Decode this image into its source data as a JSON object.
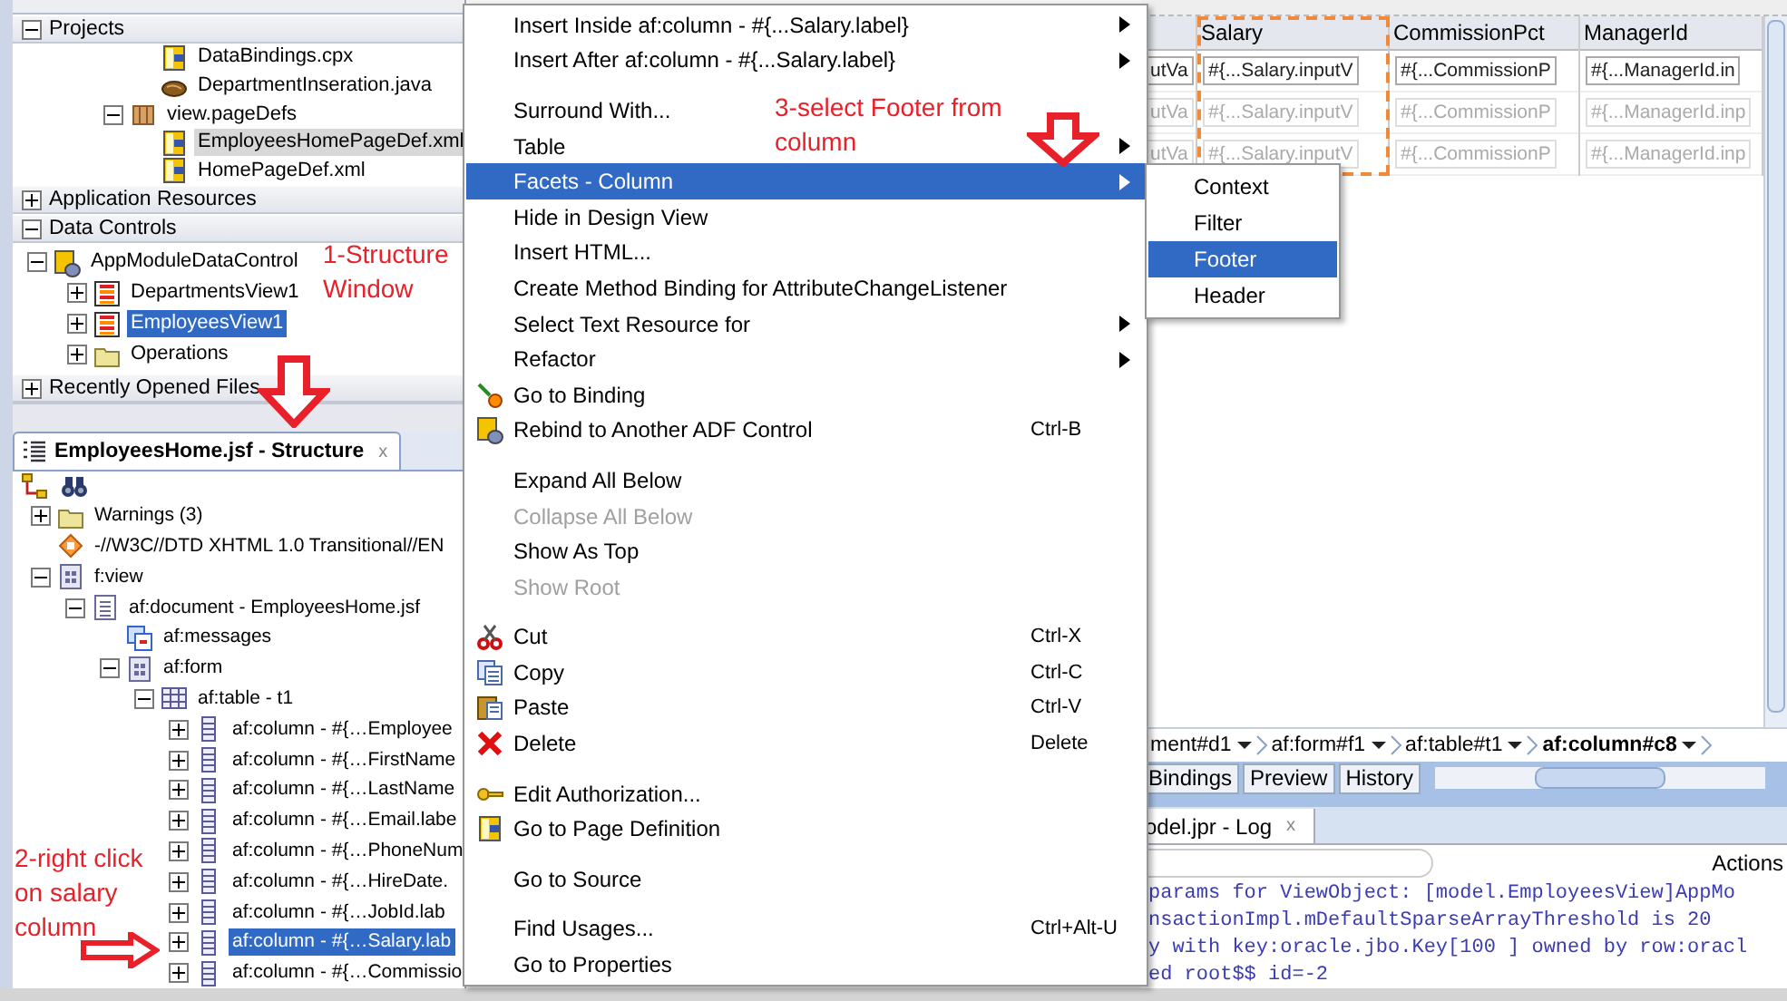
{
  "navigator": {
    "projects": {
      "header": "Projects",
      "expanded": true,
      "scrolled_items": [
        {
          "label": "DataBindings.cpx",
          "kind": "xml-file",
          "selected": false
        },
        {
          "label": "DepartmentInseration.java",
          "kind": "java-file",
          "selected": false
        }
      ],
      "items": [
        {
          "label": "view.pageDefs",
          "kind": "package",
          "expanded": true,
          "selected": false,
          "children": [
            {
              "label": "EmployeesHomePageDef.xml",
              "kind": "xml-file",
              "selected": true
            },
            {
              "label": "HomePageDef.xml",
              "kind": "xml-file",
              "selected": false
            }
          ]
        }
      ]
    },
    "application_resources": {
      "header": "Application Resources",
      "expanded": false
    },
    "data_controls": {
      "header": "Data Controls",
      "expanded": true,
      "items": [
        {
          "label": "AppModuleDataControl",
          "kind": "data-control",
          "expanded": true,
          "selected": false,
          "children": [
            {
              "label": "DepartmentsView1",
              "kind": "view-object",
              "expanded": false,
              "selected": false
            },
            {
              "label": "EmployeesView1",
              "kind": "view-object",
              "expanded": false,
              "selected": true
            },
            {
              "label": "Operations",
              "kind": "folder",
              "expanded": false,
              "selected": false
            }
          ]
        }
      ]
    },
    "recently_opened_files": {
      "header": "Recently Opened Files",
      "expanded": false
    }
  },
  "structure": {
    "tab": {
      "title": "EmployeesHome.jsf - Structure",
      "close": "x"
    },
    "items": [
      {
        "label": "Warnings (3)",
        "kind": "folder",
        "expanded": false,
        "selected": false
      },
      {
        "label": "-//W3C//DTD XHTML 1.0 Transitional//EN",
        "kind": "doctype",
        "selected": false
      },
      {
        "label": "f:view",
        "kind": "container",
        "expanded": true,
        "selected": false,
        "children": [
          {
            "label": "af:document - EmployeesHome.jsf",
            "kind": "document",
            "expanded": true,
            "selected": false,
            "children": [
              {
                "label": "af:messages",
                "kind": "messages",
                "selected": false
              },
              {
                "label": "af:form",
                "kind": "container",
                "expanded": true,
                "selected": false,
                "children": [
                  {
                    "label": "af:table - t1",
                    "kind": "table",
                    "expanded": true,
                    "selected": false,
                    "children": [
                      {
                        "label": "af:column - #{…Employee",
                        "kind": "column",
                        "expanded": false,
                        "selected": false
                      },
                      {
                        "label": "af:column - #{…FirstName",
                        "kind": "column",
                        "expanded": false,
                        "selected": false
                      },
                      {
                        "label": "af:column - #{…LastName",
                        "kind": "column",
                        "expanded": false,
                        "selected": false
                      },
                      {
                        "label": "af:column - #{…Email.labe",
                        "kind": "column",
                        "expanded": false,
                        "selected": false
                      },
                      {
                        "label": "af:column - #{…PhoneNum",
                        "kind": "column",
                        "expanded": false,
                        "selected": false
                      },
                      {
                        "label": "af:column - #{…HireDate.",
                        "kind": "column",
                        "expanded": false,
                        "selected": false
                      },
                      {
                        "label": "af:column - #{…JobId.lab",
                        "kind": "column",
                        "expanded": false,
                        "selected": false
                      },
                      {
                        "label": "af:column - #{…Salary.lab",
                        "kind": "column",
                        "expanded": false,
                        "selected": true
                      },
                      {
                        "label": "af:column - #{…Commissio",
                        "kind": "column",
                        "expanded": false,
                        "selected": false
                      }
                    ]
                  }
                ]
              }
            ]
          }
        ]
      }
    ]
  },
  "editor": {
    "table": {
      "columns": [
        {
          "label": "Salary",
          "selected": true
        },
        {
          "label": "CommissionPct",
          "selected": false
        },
        {
          "label": "ManagerId",
          "selected": false
        }
      ],
      "rows": [
        {
          "disabled": false,
          "cut_cell": "utVa",
          "cells": [
            "#{...Salary.inputV",
            "#{...CommissionP",
            "#{...ManagerId.in"
          ]
        },
        {
          "disabled": true,
          "cut_cell": "utVa",
          "cells": [
            "#{...Salary.inputV",
            "#{...CommissionP",
            "#{...ManagerId.inp"
          ]
        },
        {
          "disabled": true,
          "cut_cell": "utVa",
          "cells": [
            "#{...Salary.inputV",
            "#{...CommissionP",
            "#{...ManagerId.inp"
          ]
        }
      ]
    },
    "breadcrumb": [
      {
        "label": "ment#d1",
        "selected": false
      },
      {
        "label": "af:form#f1",
        "selected": false
      },
      {
        "label": "af:table#t1",
        "selected": false
      },
      {
        "label": "af:column#c8",
        "selected": true
      }
    ],
    "tabs": [
      {
        "label": "Bindings",
        "selected": false
      },
      {
        "label": "Preview",
        "selected": false
      },
      {
        "label": "History",
        "selected": false
      }
    ]
  },
  "log": {
    "tab": {
      "title": "odel.jpr - Log",
      "close": "x"
    },
    "actions": "Actions",
    "lines": [
      "params for ViewObject: [model.EmployeesView]AppMo",
      "nsactionImpl.mDefaultSparseArrayThreshold is 20",
      "y with key:oracle.jbo.Key[100 ] owned by row:oracl",
      "ed root$$ id=-2"
    ]
  },
  "context_menu": {
    "items": [
      {
        "kind": "item",
        "label": "Insert Inside af:column - #{...Salary.label}",
        "submenu": true,
        "disabled": false,
        "selected": false
      },
      {
        "kind": "item",
        "label": "Insert After af:column - #{...Salary.label}",
        "submenu": true,
        "disabled": false,
        "selected": false
      },
      {
        "kind": "separator"
      },
      {
        "kind": "item",
        "label": "Surround With...",
        "submenu": false,
        "disabled": false,
        "selected": false
      },
      {
        "kind": "item",
        "label": "Table",
        "submenu": true,
        "disabled": false,
        "selected": false
      },
      {
        "kind": "item",
        "label": "Facets - Column",
        "submenu": true,
        "disabled": false,
        "selected": true
      },
      {
        "kind": "item",
        "label": "Hide in Design View",
        "submenu": false,
        "disabled": false,
        "selected": false
      },
      {
        "kind": "item",
        "label": "Insert HTML...",
        "submenu": false,
        "disabled": false,
        "selected": false
      },
      {
        "kind": "item",
        "label": "Create Method Binding for AttributeChangeListener",
        "submenu": false,
        "disabled": false,
        "selected": false
      },
      {
        "kind": "item",
        "label": "Select Text Resource for",
        "submenu": true,
        "disabled": false,
        "selected": false
      },
      {
        "kind": "item",
        "label": "Refactor",
        "submenu": true,
        "disabled": false,
        "selected": false
      },
      {
        "kind": "item",
        "label": "Go to Binding",
        "submenu": false,
        "disabled": false,
        "selected": false
      },
      {
        "kind": "item",
        "label": "Rebind to Another ADF Control",
        "shortcut": "Ctrl-B",
        "submenu": false,
        "disabled": false,
        "selected": false
      },
      {
        "kind": "separator"
      },
      {
        "kind": "item",
        "label": "Expand All Below",
        "submenu": false,
        "disabled": false,
        "selected": false
      },
      {
        "kind": "item",
        "label": "Collapse All Below",
        "submenu": false,
        "disabled": true,
        "selected": false
      },
      {
        "kind": "item",
        "label": "Show As Top",
        "submenu": false,
        "disabled": false,
        "selected": false
      },
      {
        "kind": "item",
        "label": "Show Root",
        "submenu": false,
        "disabled": true,
        "selected": false
      },
      {
        "kind": "separator"
      },
      {
        "kind": "item",
        "label": "Cut",
        "shortcut": "Ctrl-X",
        "submenu": false,
        "disabled": false,
        "selected": false
      },
      {
        "kind": "item",
        "label": "Copy",
        "shortcut": "Ctrl-C",
        "submenu": false,
        "disabled": false,
        "selected": false
      },
      {
        "kind": "item",
        "label": "Paste",
        "shortcut": "Ctrl-V",
        "submenu": false,
        "disabled": false,
        "selected": false
      },
      {
        "kind": "item",
        "label": "Delete",
        "shortcut": "Delete",
        "submenu": false,
        "disabled": false,
        "selected": false
      },
      {
        "kind": "separator"
      },
      {
        "kind": "item",
        "label": "Edit Authorization...",
        "submenu": false,
        "disabled": false,
        "selected": false
      },
      {
        "kind": "item",
        "label": "Go to Page Definition",
        "submenu": false,
        "disabled": false,
        "selected": false
      },
      {
        "kind": "separator"
      },
      {
        "kind": "item",
        "label": "Go to Source",
        "submenu": false,
        "disabled": false,
        "selected": false
      },
      {
        "kind": "separator"
      },
      {
        "kind": "item",
        "label": "Find Usages...",
        "shortcut": "Ctrl+Alt-U",
        "submenu": false,
        "disabled": false,
        "selected": false
      },
      {
        "kind": "item",
        "label": "Go to Properties",
        "submenu": false,
        "disabled": false,
        "selected": false
      }
    ]
  },
  "submenu": {
    "items": [
      {
        "label": "Context",
        "selected": false
      },
      {
        "label": "Filter",
        "selected": false
      },
      {
        "label": "Footer",
        "selected": true
      },
      {
        "label": "Header",
        "selected": false
      }
    ]
  },
  "annotations": [
    "1-Structure Window",
    "3-select Footer from column",
    "2-right click on salary column"
  ]
}
